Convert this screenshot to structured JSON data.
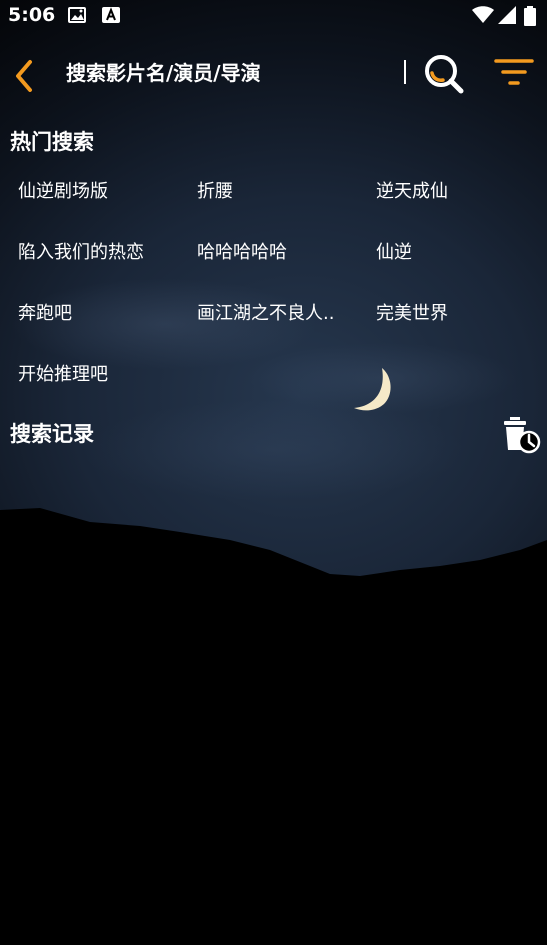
{
  "status_bar": {
    "time": "5:06",
    "left_icons": [
      "image-icon",
      "a-badge-icon"
    ],
    "right_icons": [
      "wifi-icon",
      "signal-icon",
      "battery-icon"
    ]
  },
  "header": {
    "back_icon": "chevron-left-icon",
    "search_placeholder": "搜索影片名/演员/导演",
    "search_icon": "search-icon",
    "filter_icon": "filter-icon",
    "accent_color": "#f39a1f"
  },
  "hot_search": {
    "title": "热门搜索",
    "items": [
      "仙逆剧场版",
      "折腰",
      "逆天成仙",
      "陷入我们的热恋",
      "哈哈哈哈哈",
      "仙逆",
      "奔跑吧",
      "画江湖之不良人..",
      "完美世界",
      "开始推理吧"
    ]
  },
  "history": {
    "title": "搜索记录",
    "clear_icon": "delete-history-icon"
  }
}
